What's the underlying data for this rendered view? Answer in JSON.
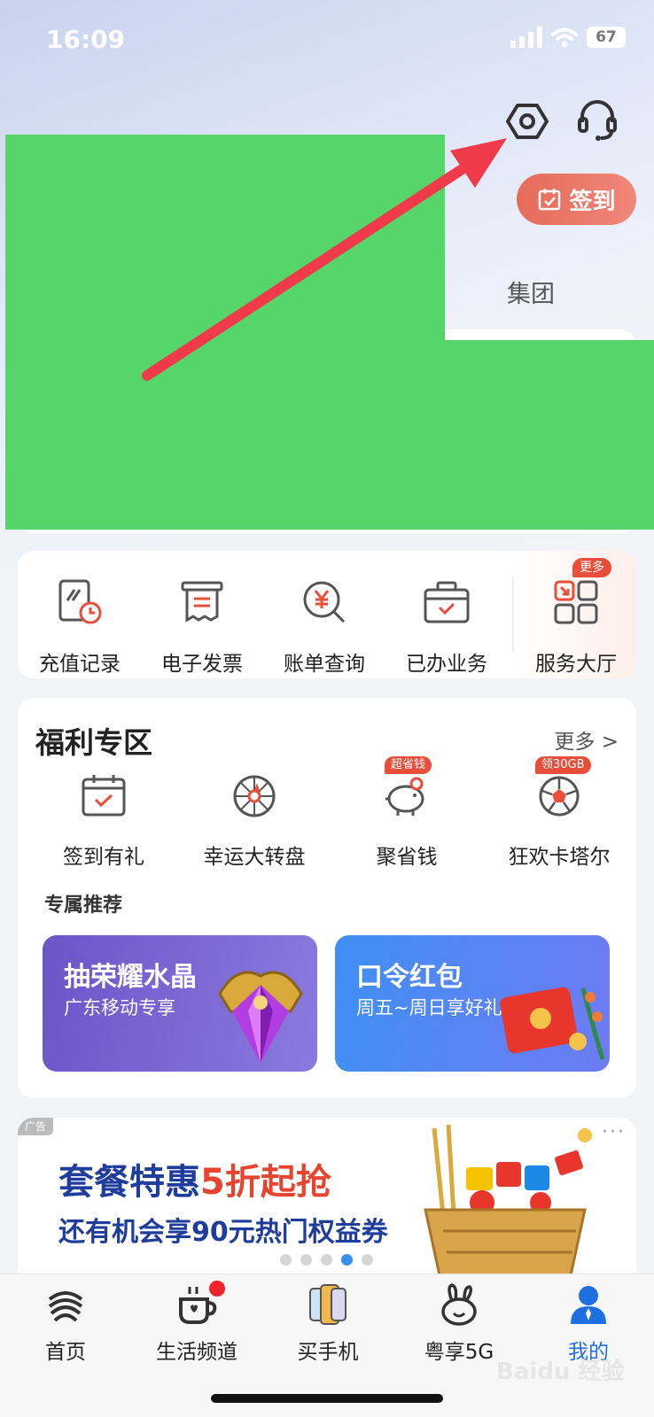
{
  "status_bar": {
    "time": "16:09",
    "battery": "67"
  },
  "header": {
    "signin_label": "签到",
    "group_label": "集团"
  },
  "quick_actions": [
    {
      "label": "充值记录",
      "icon": "recharge-record-icon"
    },
    {
      "label": "电子发票",
      "icon": "invoice-icon"
    },
    {
      "label": "账单查询",
      "icon": "bill-query-icon"
    },
    {
      "label": "已办业务",
      "icon": "completed-business-icon"
    },
    {
      "label": "服务大厅",
      "icon": "service-hall-icon"
    }
  ],
  "quick_more_badge": "更多",
  "welfare": {
    "title": "福利专区",
    "more": "更多 >",
    "items": [
      {
        "label": "签到有礼",
        "icon": "calendar-check-icon"
      },
      {
        "label": "幸运大转盘",
        "icon": "lucky-wheel-icon"
      },
      {
        "label": "聚省钱",
        "icon": "piggy-bank-icon",
        "badge": "超省钱"
      },
      {
        "label": "狂欢卡塔尔",
        "icon": "football-icon",
        "badge": "领30GB"
      }
    ],
    "recommend_title": "专属推荐",
    "promos": [
      {
        "title": "抽荣耀水晶",
        "subtitle": "广东移动专享"
      },
      {
        "title": "口令红包",
        "subtitle": "周五~周日享好礼"
      }
    ]
  },
  "ad": {
    "tag": "广告",
    "line1_a": "套餐特惠",
    "line1_b": "5折起抢",
    "line2": "还有机会享90元热门权益券",
    "menu": "···"
  },
  "tabs": [
    {
      "label": "首页",
      "icon": "china-mobile-logo-icon"
    },
    {
      "label": "生活频道",
      "icon": "coffee-cup-icon"
    },
    {
      "label": "买手机",
      "icon": "phone-icon"
    },
    {
      "label": "粤享5G",
      "icon": "rabbit-icon"
    },
    {
      "label": "我的",
      "icon": "user-icon"
    }
  ],
  "watermark": "Baidu 经验",
  "colors": {
    "accent": "#e84e3a",
    "active_tab": "#1e6fe0",
    "redaction": "#55d56a",
    "arrow": "#f03a4a"
  }
}
